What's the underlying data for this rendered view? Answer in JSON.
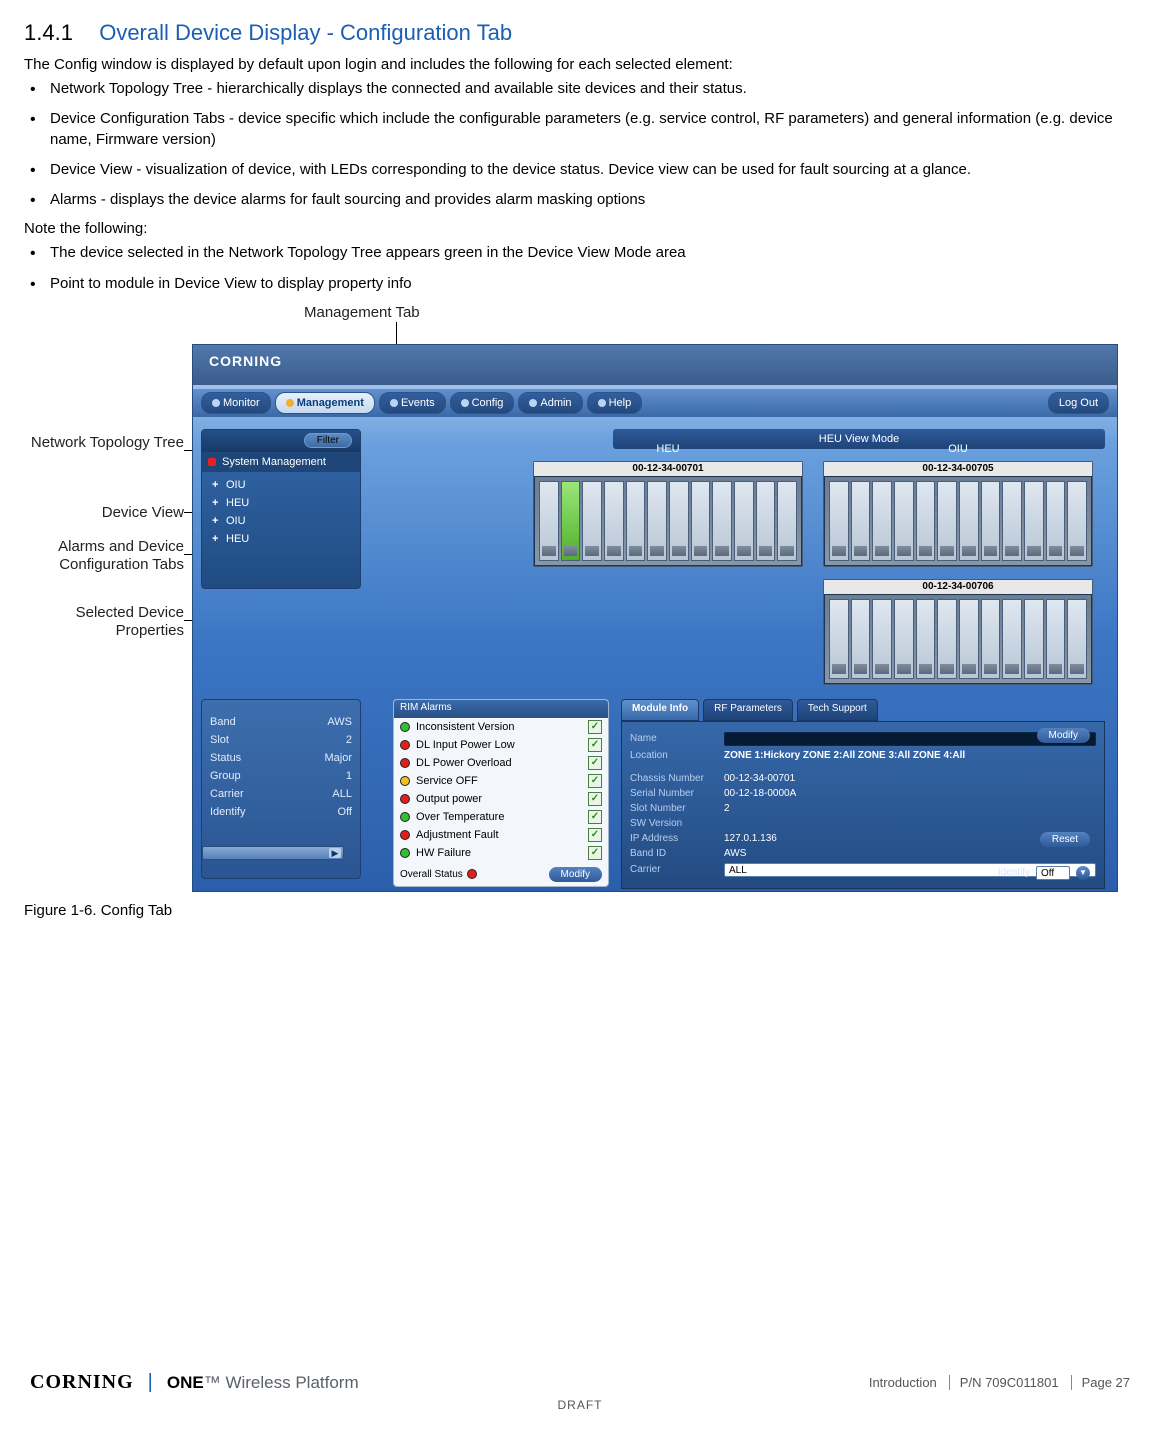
{
  "section": {
    "number": "1.4.1",
    "title": "Overall Device Display - Configuration Tab"
  },
  "intro": "The Config window is displayed by default upon login and includes the following for each selected element:",
  "bullets1": [
    "Network Topology Tree - hierarchically displays the connected and available site devices and their status.",
    "Device Configuration Tabs - device specific which include the configurable parameters (e.g. service control, RF parameters) and general information (e.g. device name, Firmware version)",
    "Device View - visualization of device, with LEDs corresponding to the device status. Device view can be used for fault sourcing at a glance.",
    "Alarms - displays the device alarms for fault sourcing and provides alarm masking options"
  ],
  "note_head": "Note the following:",
  "bullets2": [
    "The device selected in the Network Topology Tree appears green in the Device View Mode area",
    "Point to module in Device View to display property info"
  ],
  "callouts": {
    "mgmt": "Management Tab",
    "tree": "Network Topology Tree",
    "device_view": "Device View",
    "tabs": "Alarms and Device Configuration Tabs",
    "props": "Selected Device Properties"
  },
  "figure_caption": "Figure 1-6. Config Tab",
  "screenshot": {
    "logo": "CORNING",
    "top_tabs": [
      "Monitor",
      "Management",
      "Events",
      "Config",
      "Admin",
      "Help"
    ],
    "logout": "Log Out",
    "tree": {
      "filter_btn": "Filter",
      "current": "System Management",
      "items": [
        "OIU",
        "HEU",
        "OIU",
        "HEU"
      ]
    },
    "view_mode_label": "HEU View Mode",
    "col_headers": {
      "left": "HEU",
      "right": "OIU"
    },
    "serials": {
      "c1": "00-12-34-00701",
      "c2": "00-12-34-00705",
      "c3": "00-12-34-00706"
    },
    "props": [
      [
        "Band",
        "AWS"
      ],
      [
        "Slot",
        "2"
      ],
      [
        "Status",
        "Major"
      ],
      [
        "Group",
        "1"
      ],
      [
        "Carrier",
        "ALL"
      ],
      [
        "Identify",
        "Off"
      ]
    ],
    "alarms": {
      "header": "RIM Alarms",
      "items": [
        [
          "g",
          "Inconsistent Version"
        ],
        [
          "r",
          "DL Input Power Low"
        ],
        [
          "r",
          "DL Power Overload"
        ],
        [
          "y",
          "Service OFF"
        ],
        [
          "r",
          "Output power"
        ],
        [
          "g",
          "Over Temperature"
        ],
        [
          "r",
          "Adjustment Fault"
        ],
        [
          "g",
          "HW Failure"
        ]
      ],
      "overall_label": "Overall Status",
      "modify": "Modify"
    },
    "info_tabs": [
      "Module Info",
      "RF Parameters",
      "Tech Support"
    ],
    "module_info": {
      "name_label": "Name",
      "location_label": "Location",
      "location_value": "ZONE 1:Hickory ZONE 2:All ZONE 3:All ZONE 4:All",
      "rows": [
        [
          "Chassis Number",
          "00-12-34-00701"
        ],
        [
          "Serial Number",
          "00-12-18-0000A"
        ],
        [
          "Slot Number",
          "2"
        ],
        [
          "SW Version",
          ""
        ],
        [
          "IP Address",
          "127.0.1.136"
        ],
        [
          "Band ID",
          "AWS"
        ],
        [
          "Carrier",
          "ALL"
        ]
      ],
      "modify": "Modify",
      "reset": "Reset",
      "identify_label": "Identify",
      "identify_val": "Off"
    }
  },
  "footer": {
    "brand": "CORNING",
    "platform_a": "ONE",
    "platform_b": "™ Wireless Platform",
    "section_name": "Introduction",
    "pn": "P/N 709C011801",
    "page": "Page 27",
    "draft": "DRAFT"
  }
}
